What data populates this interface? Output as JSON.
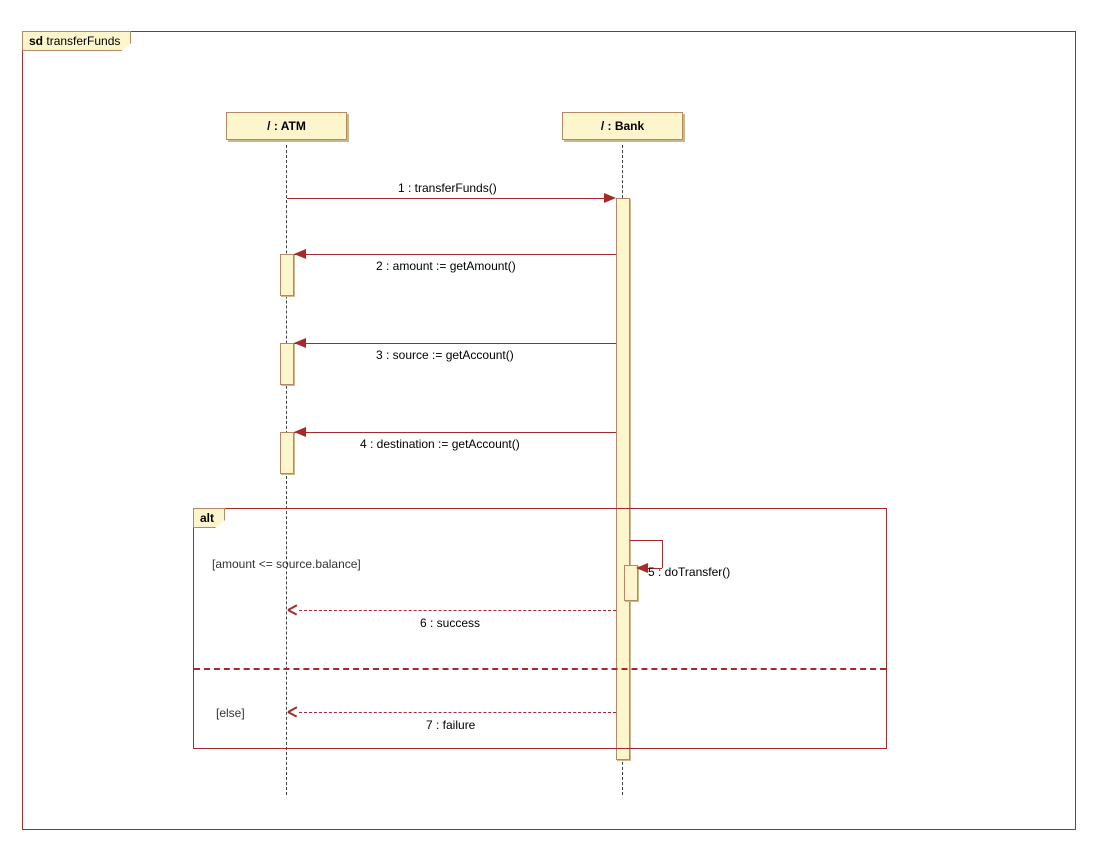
{
  "diagram": {
    "frame_prefix": "sd",
    "frame_name": "transferFunds",
    "lifelines": {
      "atm": {
        "label": "/ : ATM"
      },
      "bank": {
        "label": "/ : Bank"
      }
    },
    "messages": {
      "m1": "1 : transferFunds()",
      "m2": "2 : amount := getAmount()",
      "m3": "3 : source := getAccount()",
      "m4": "4 : destination := getAccount()",
      "m5": "5 : doTransfer()",
      "m6": "6 : success",
      "m7": "7 : failure"
    },
    "alt": {
      "label": "alt",
      "guard1": "[amount <= source.balance]",
      "guard2": "[else]"
    }
  }
}
